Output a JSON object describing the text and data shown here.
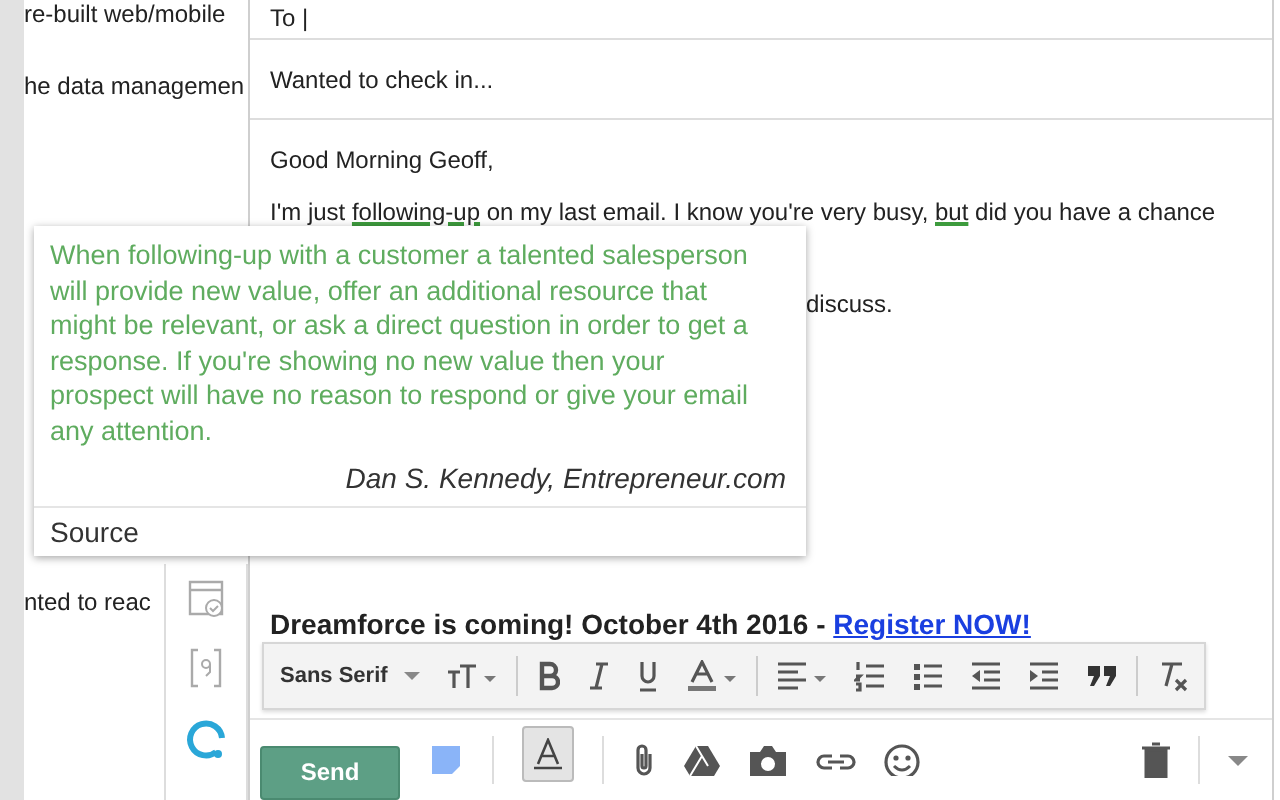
{
  "background_page": {
    "lines_top": [
      "re-built web/mobile",
      "he data managemen"
    ],
    "line_bottom": "nted to reac"
  },
  "extension_sidebar": {
    "icons": [
      {
        "kind": "calendar"
      },
      {
        "kind": "brackets"
      },
      {
        "kind": "ring"
      }
    ]
  },
  "compose": {
    "to_label": "To |",
    "subject": "Wanted to check in...",
    "greeting": "Good Morning Geoff,",
    "paragraph": [
      {
        "text": "I'm just ",
        "flagged": false
      },
      {
        "text": "following-up",
        "flagged": true
      },
      {
        "text": " on my last email. I know you're very busy, ",
        "flagged": false
      },
      {
        "text": "but",
        "flagged": true
      },
      {
        "text": " did you have a chance",
        "flagged": false
      }
    ],
    "fragment": "discuss.",
    "signature": {
      "text": "Dreamforce is coming! October 4th 2016 - ",
      "link": "Register NOW!"
    },
    "format_toolbar": {
      "font": "Sans Serif",
      "tools": [
        {
          "kind": "size"
        },
        {
          "kind": "bold"
        },
        {
          "kind": "italic"
        },
        {
          "kind": "underline"
        },
        {
          "kind": "color"
        },
        {
          "kind": "align"
        },
        {
          "kind": "numbered"
        },
        {
          "kind": "bulleted"
        },
        {
          "kind": "outdent"
        },
        {
          "kind": "indent"
        },
        {
          "kind": "quote"
        },
        {
          "kind": "clear"
        }
      ]
    },
    "bottom_bar": {
      "send": "Send",
      "formatting_selected": true,
      "tools": [
        {
          "kind": "attach"
        },
        {
          "kind": "drive"
        },
        {
          "kind": "camera"
        },
        {
          "kind": "link"
        },
        {
          "kind": "emoji"
        }
      ]
    }
  },
  "tip": {
    "text": "When following-up with a customer a talented salesperson will provide new value, offer an additional resource that might be relevant, or ask a direct question in order to get a response. If you're showing no new value then your prospect will have no reason to respond or give your email any attention.",
    "attribution": "Dan S. Kennedy, Entrepreneur.com",
    "source_label": "Source"
  }
}
